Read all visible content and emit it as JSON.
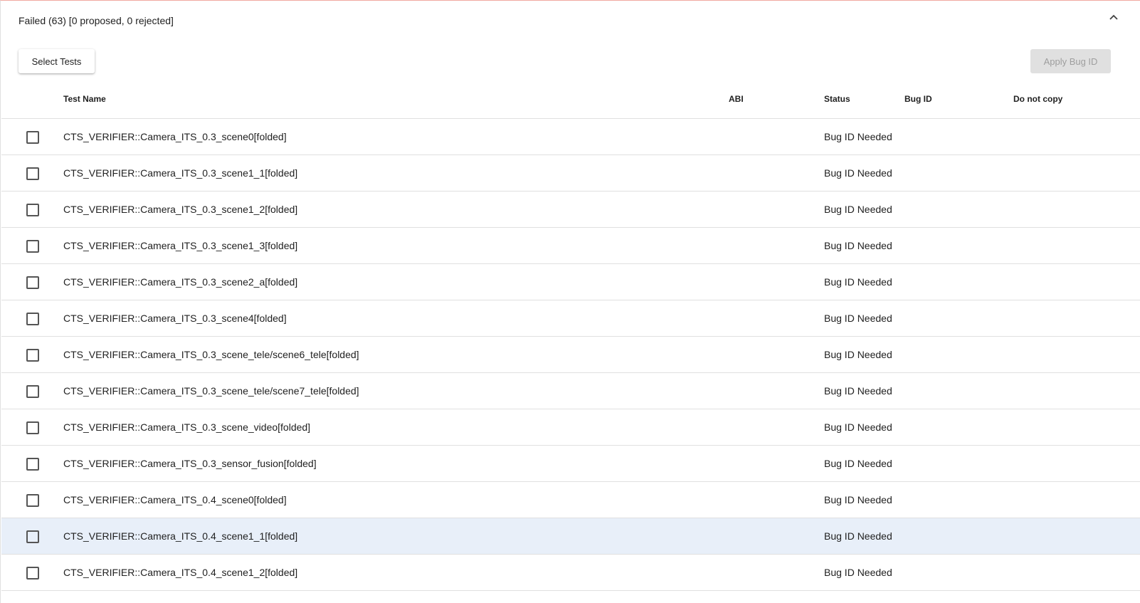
{
  "panel": {
    "title": "Failed (63) [0 proposed, 0 rejected]",
    "collapse_icon": "chevron-up-icon"
  },
  "toolbar": {
    "select_tests_label": "Select Tests",
    "apply_bug_id_label": "Apply Bug ID"
  },
  "table": {
    "headers": {
      "test_name": "Test Name",
      "abi": "ABI",
      "status": "Status",
      "bug_id": "Bug ID",
      "do_not_copy": "Do not copy"
    },
    "rows": [
      {
        "name": "CTS_VERIFIER::Camera_ITS_0.3_scene0[folded]",
        "abi": "",
        "status": "Bug ID Needed",
        "bug_id": "",
        "do_not_copy": ""
      },
      {
        "name": "CTS_VERIFIER::Camera_ITS_0.3_scene1_1[folded]",
        "abi": "",
        "status": "Bug ID Needed",
        "bug_id": "",
        "do_not_copy": ""
      },
      {
        "name": "CTS_VERIFIER::Camera_ITS_0.3_scene1_2[folded]",
        "abi": "",
        "status": "Bug ID Needed",
        "bug_id": "",
        "do_not_copy": ""
      },
      {
        "name": "CTS_VERIFIER::Camera_ITS_0.3_scene1_3[folded]",
        "abi": "",
        "status": "Bug ID Needed",
        "bug_id": "",
        "do_not_copy": ""
      },
      {
        "name": "CTS_VERIFIER::Camera_ITS_0.3_scene2_a[folded]",
        "abi": "",
        "status": "Bug ID Needed",
        "bug_id": "",
        "do_not_copy": ""
      },
      {
        "name": "CTS_VERIFIER::Camera_ITS_0.3_scene4[folded]",
        "abi": "",
        "status": "Bug ID Needed",
        "bug_id": "",
        "do_not_copy": ""
      },
      {
        "name": "CTS_VERIFIER::Camera_ITS_0.3_scene_tele/scene6_tele[folded]",
        "abi": "",
        "status": "Bug ID Needed",
        "bug_id": "",
        "do_not_copy": ""
      },
      {
        "name": "CTS_VERIFIER::Camera_ITS_0.3_scene_tele/scene7_tele[folded]",
        "abi": "",
        "status": "Bug ID Needed",
        "bug_id": "",
        "do_not_copy": ""
      },
      {
        "name": "CTS_VERIFIER::Camera_ITS_0.3_scene_video[folded]",
        "abi": "",
        "status": "Bug ID Needed",
        "bug_id": "",
        "do_not_copy": ""
      },
      {
        "name": "CTS_VERIFIER::Camera_ITS_0.3_sensor_fusion[folded]",
        "abi": "",
        "status": "Bug ID Needed",
        "bug_id": "",
        "do_not_copy": ""
      },
      {
        "name": "CTS_VERIFIER::Camera_ITS_0.4_scene0[folded]",
        "abi": "",
        "status": "Bug ID Needed",
        "bug_id": "",
        "do_not_copy": ""
      },
      {
        "name": "CTS_VERIFIER::Camera_ITS_0.4_scene1_1[folded]",
        "abi": "",
        "status": "Bug ID Needed",
        "bug_id": "",
        "do_not_copy": ""
      },
      {
        "name": "CTS_VERIFIER::Camera_ITS_0.4_scene1_2[folded]",
        "abi": "",
        "status": "Bug ID Needed",
        "bug_id": "",
        "do_not_copy": ""
      }
    ],
    "hovered_row_index": 11
  },
  "colors": {
    "header_border_accent": "#f1a9a0",
    "row_hover_background": "#e8eff9",
    "disabled_button_background": "#e0e0e0",
    "disabled_button_text": "#9e9e9e"
  }
}
